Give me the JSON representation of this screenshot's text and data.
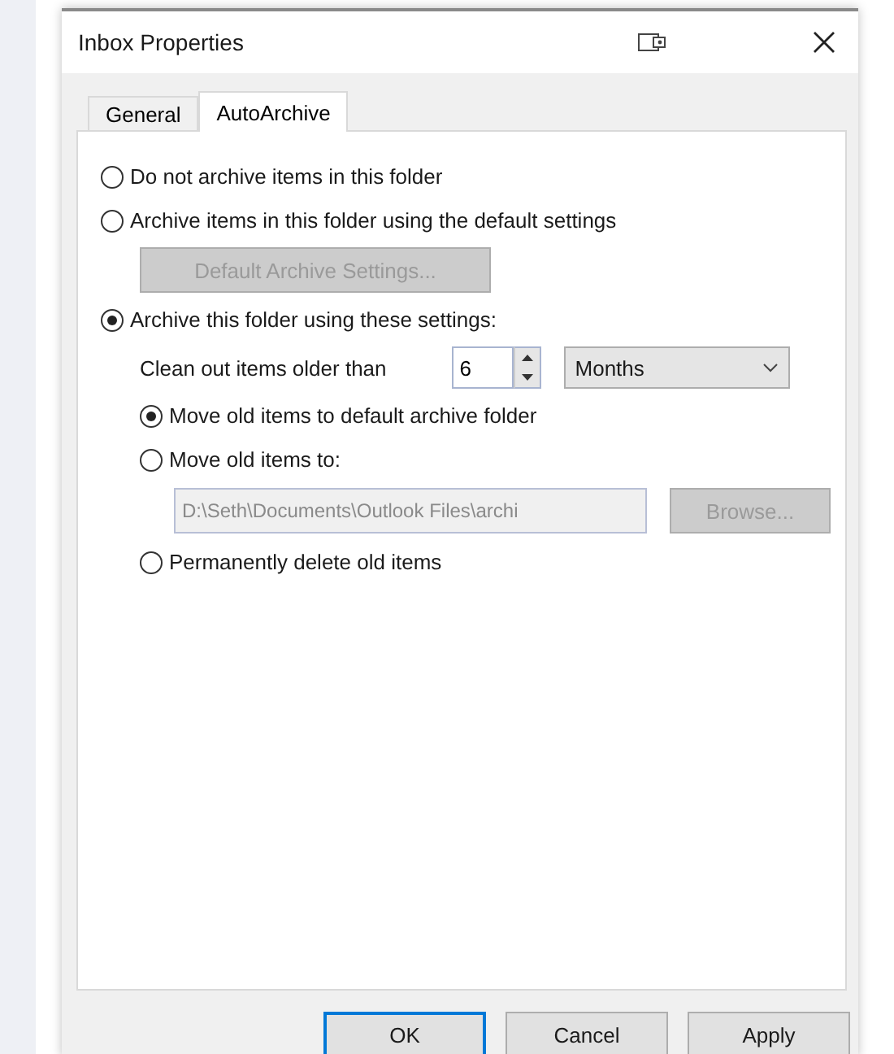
{
  "window": {
    "title": "Inbox Properties"
  },
  "tabs": [
    {
      "label": "General",
      "selected": false
    },
    {
      "label": "AutoArchive",
      "selected": true
    }
  ],
  "archive_options": [
    {
      "label": "Do not archive items in this folder",
      "selected": false
    },
    {
      "label": "Archive items in this folder using the default settings",
      "selected": false,
      "button": {
        "label": "Default Archive Settings...",
        "disabled": true
      }
    },
    {
      "label": "Archive this folder using these settings:",
      "selected": true
    }
  ],
  "clean_out": {
    "label": "Clean out items older than",
    "value": "6",
    "unit": "Months"
  },
  "old_items_options": [
    {
      "label": "Move old items to default archive folder",
      "selected": true
    },
    {
      "label": "Move old items to:",
      "selected": false,
      "path": {
        "value": "D:\\Seth\\Documents\\Outlook Files\\archi",
        "disabled": true
      },
      "button": {
        "label": "Browse...",
        "disabled": true
      }
    },
    {
      "label": "Permanently delete old items",
      "selected": false
    }
  ],
  "buttons": [
    {
      "label": "OK",
      "default": true
    },
    {
      "label": "Cancel",
      "default": false
    },
    {
      "label": "Apply",
      "default": false
    }
  ]
}
